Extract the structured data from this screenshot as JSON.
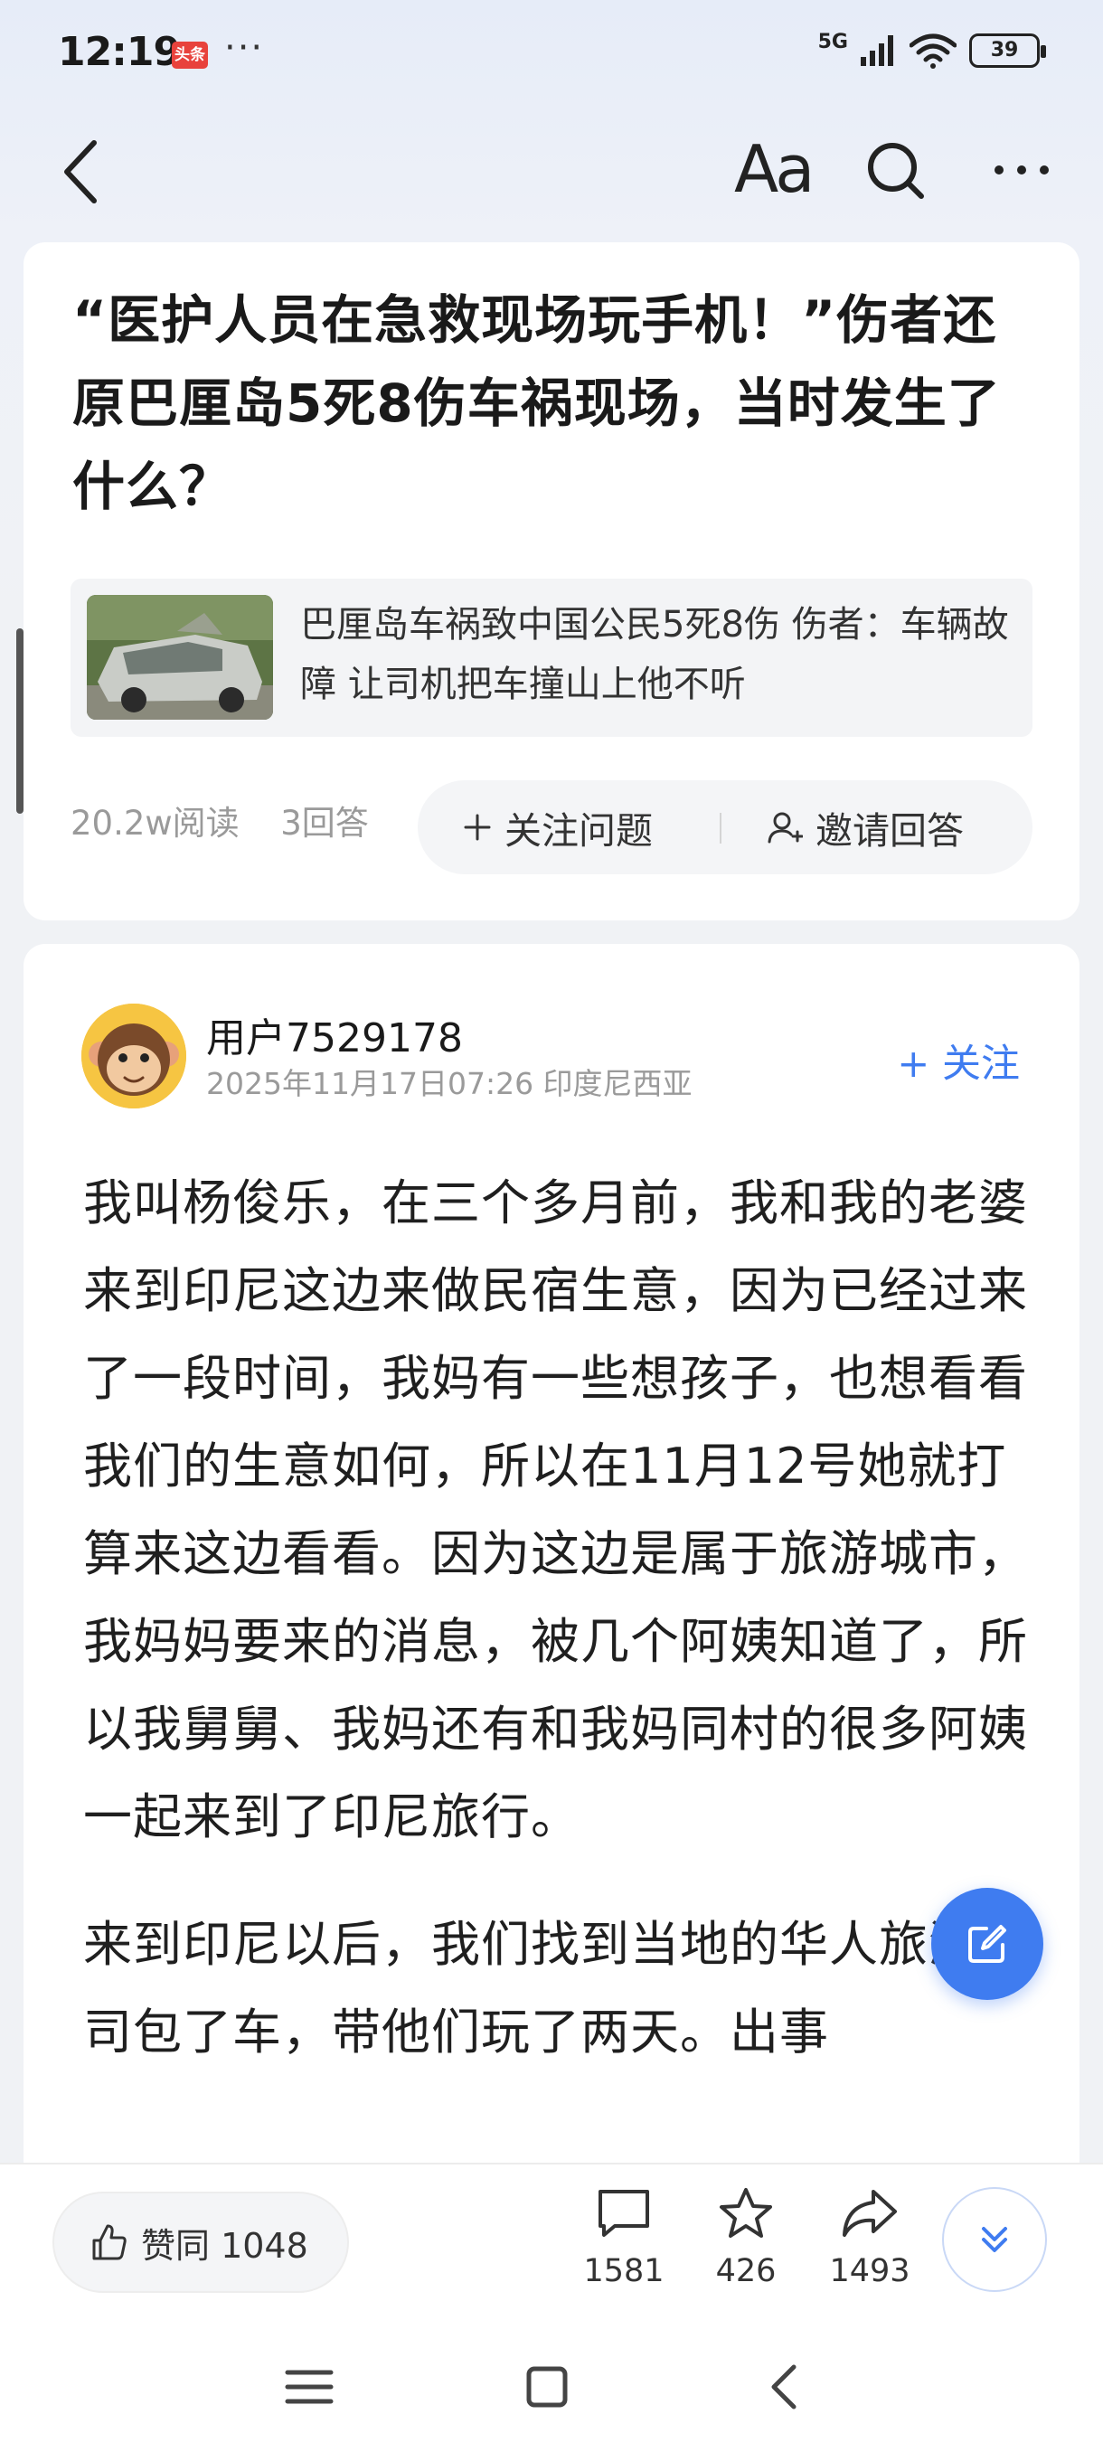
{
  "status_bar": {
    "time": "12:19",
    "app_badge": "头条",
    "more": "···",
    "network": "5G",
    "battery": "39"
  },
  "nav": {
    "font_button": "Aa",
    "icons": [
      "back-icon",
      "font-size-icon",
      "search-icon",
      "more-icon"
    ]
  },
  "question": {
    "title": "“医护人员在急救现场玩手机！”伤者还原巴厘岛5死8伤车祸现场，当时发生了什么？",
    "news": {
      "text": "巴厘岛车祸致中国公民5死8伤 伤者：车辆故障 让司机把车撞山上他不听"
    },
    "reads": "20.2w阅读",
    "answers": "3回答",
    "follow_label": "关注问题",
    "invite_label": "邀请回答"
  },
  "answer": {
    "username": "用户7529178",
    "meta": "2025年11月17日07:26 印度尼西亚",
    "follow_label": "+ 关注",
    "paragraphs": [
      "我叫杨俊乐，在三个多月前，我和我的老婆来到印尼这边来做民宿生意，因为已经过来了一段时间，我妈有一些想孩子，也想看看我们的生意如何，所以在11月12号她就打算来这边看看。因为这边是属于旅游城市，我妈妈要来的消息，被几个阿姨知道了，所以我舅舅、我妈还有和我妈同村的很多阿姨一起来到了印尼旅行。",
      "来到印尼以后，我们找到当地的华人旅游公司包了车，带他们玩了两天。出事"
    ]
  },
  "bottom_bar": {
    "like_label": "赞同 1048",
    "comments": "1581",
    "favorites": "426",
    "shares": "1493"
  },
  "colors": {
    "accent": "#3f7cf0",
    "text": "#1f1f1f",
    "muted": "#9a9a9a",
    "background": "#f0f2f5"
  }
}
